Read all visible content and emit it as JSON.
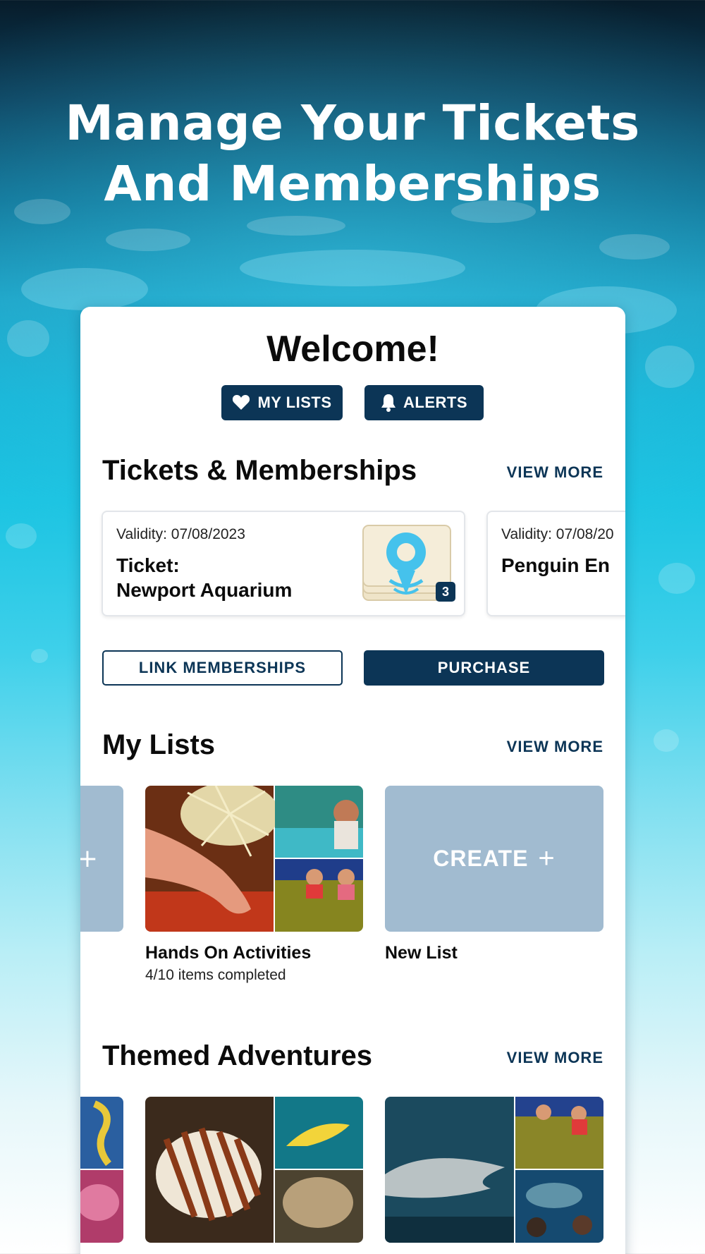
{
  "hero": {
    "title_line1": "Manage Your Tickets",
    "title_line2": "And Memberships"
  },
  "welcome": {
    "title": "Welcome!",
    "my_lists_button": "MY LISTS",
    "alerts_button": "ALERTS"
  },
  "tickets_section": {
    "title": "Tickets & Memberships",
    "view_more": "VIEW MORE",
    "cards": [
      {
        "validity": "Validity: 07/08/2023",
        "name_line1": "Ticket:",
        "name_line2": "Newport Aquarium",
        "count": "3"
      },
      {
        "validity": "Validity: 07/08/20",
        "name_line1": "Penguin En"
      }
    ],
    "link_button": "LINK MEMBERSHIPS",
    "purchase_button": "PURCHASE"
  },
  "lists_section": {
    "title": "My Lists",
    "view_more": "VIEW MORE",
    "items": [
      {
        "title": "Hands On Activities",
        "subtitle": "4/10 items completed"
      },
      {
        "title": "New List",
        "create_label": "CREATE"
      }
    ]
  },
  "themed_section": {
    "title": "Themed Adventures",
    "view_more": "VIEW MORE"
  },
  "colors": {
    "navy": "#0c3556",
    "tile_blue": "#a1bbd0",
    "ocean": "#16b6d8"
  }
}
